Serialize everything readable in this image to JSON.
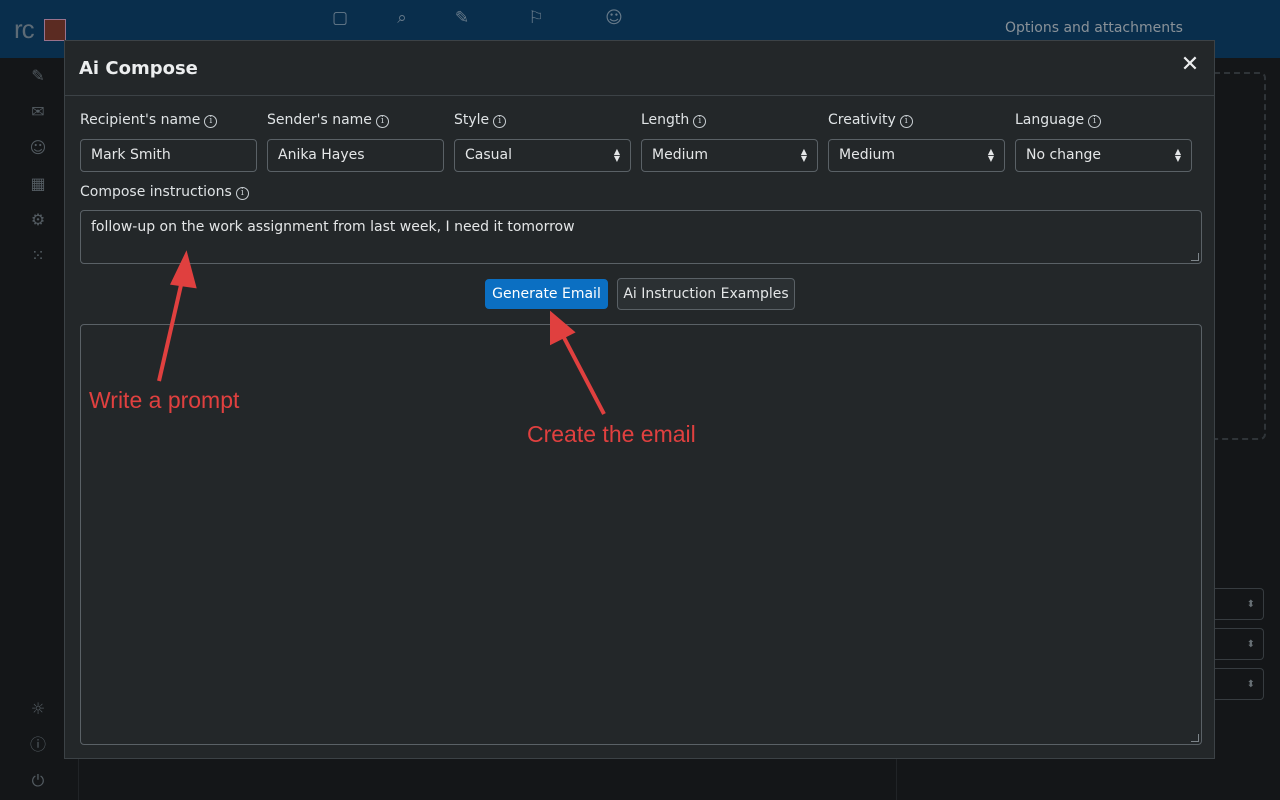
{
  "app": {
    "logo_text": "rc",
    "right_panel_title": "Options and attachments",
    "toolbar_icons": [
      "save-icon",
      "attachment-icon",
      "signature-icon",
      "bookmark-icon",
      "robot-icon"
    ],
    "left_nav_icons": [
      "compose-icon",
      "mail-icon",
      "contacts-icon",
      "calendar-icon",
      "settings-icon",
      "apps-icon",
      "theme-icon",
      "info-icon",
      "power-icon"
    ]
  },
  "modal": {
    "title": "Ai Compose",
    "close_glyph": "✕",
    "fields": {
      "recipient": {
        "label": "Recipient's name",
        "value": "Mark Smith"
      },
      "sender": {
        "label": "Sender's name",
        "value": "Anika Hayes"
      },
      "style": {
        "label": "Style",
        "value": "Casual"
      },
      "length": {
        "label": "Length",
        "value": "Medium"
      },
      "creativity": {
        "label": "Creativity",
        "value": "Medium"
      },
      "language": {
        "label": "Language",
        "value": "No change"
      }
    },
    "instructions": {
      "label": "Compose instructions",
      "value": "follow-up on the work assignment from last week, I need it tomorrow"
    },
    "generate_button": "Generate Email",
    "examples_button": "Ai Instruction Examples",
    "output_value": ""
  },
  "annotations": {
    "prompt_note": "Write a prompt",
    "create_note": "Create the email",
    "color": "#e0403f"
  },
  "colors": {
    "topbar": "#0c3e66",
    "primary": "#0b6fc2",
    "modal_bg": "#232729"
  }
}
